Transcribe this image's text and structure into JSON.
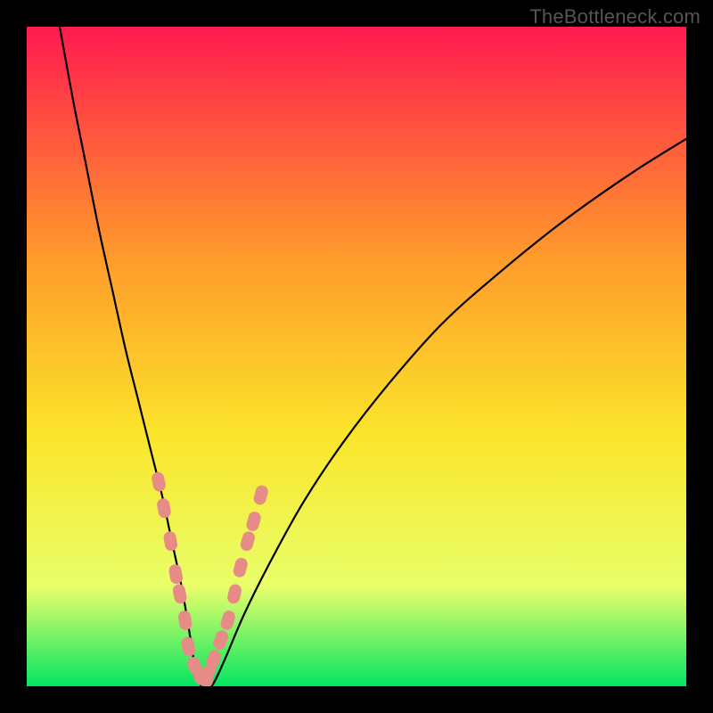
{
  "watermark": "TheBottleneck.com",
  "colors": {
    "frame": "#000000",
    "curve": "#000000",
    "marker_fill": "#e78b87",
    "marker_stroke": "#d26e69",
    "gradient_top": "#ff1a4f",
    "gradient_upper_mid": "#ff9b2b",
    "gradient_mid": "#fbe52b",
    "gradient_low": "#e8ff6a",
    "gradient_bottom": "#04e561",
    "watermark": "#555555"
  },
  "chart_data": {
    "type": "line",
    "title": "",
    "xlabel": "",
    "ylabel": "",
    "xlim": [
      0,
      100
    ],
    "ylim": [
      0,
      100
    ],
    "x": [
      5,
      7,
      9,
      11,
      13,
      15,
      17,
      19,
      20.5,
      22,
      23.5,
      24.7,
      25.5,
      26.5,
      28,
      30,
      33,
      37,
      42,
      48,
      55,
      63,
      72,
      82,
      92,
      100
    ],
    "values": [
      100,
      89,
      79,
      69,
      60,
      51,
      43,
      35,
      29,
      22,
      15,
      8,
      3,
      0,
      0,
      4,
      11,
      19,
      28,
      37,
      46,
      55,
      63,
      71,
      78,
      83
    ],
    "series": [
      {
        "name": "curve",
        "x": [
          5,
          7,
          9,
          11,
          13,
          15,
          17,
          19,
          20.5,
          22,
          23.5,
          24.7,
          25.5,
          26.5,
          28,
          30,
          33,
          37,
          42,
          48,
          55,
          63,
          72,
          82,
          92,
          100
        ],
        "values": [
          100,
          89,
          79,
          69,
          60,
          51,
          43,
          35,
          29,
          22,
          15,
          8,
          3,
          0,
          0,
          4,
          11,
          19,
          28,
          37,
          46,
          55,
          63,
          71,
          78,
          83
        ]
      },
      {
        "name": "markers",
        "x": [
          20.0,
          20.8,
          21.8,
          22.6,
          23.2,
          24.0,
          24.5,
          25.5,
          26.8,
          27.5,
          28.3,
          29.4,
          30.5,
          31.5,
          32.4,
          33.5,
          34.4,
          35.5
        ],
        "values": [
          31,
          27,
          22,
          17,
          14,
          10,
          6,
          3,
          1,
          2,
          4,
          7,
          10,
          14,
          18,
          22,
          25,
          29
        ]
      }
    ],
    "annotations": []
  }
}
